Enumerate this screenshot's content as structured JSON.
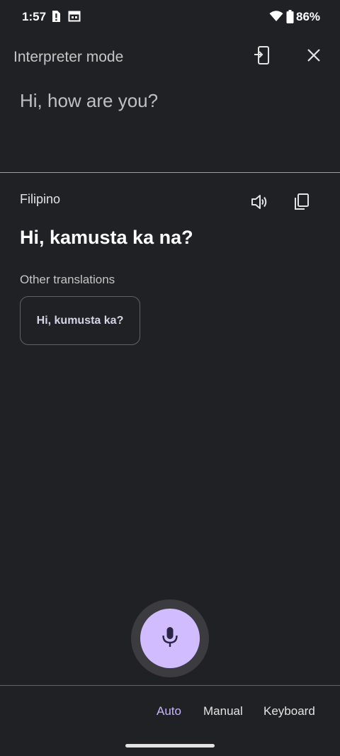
{
  "status_bar": {
    "time": "1:57",
    "battery": "86%",
    "icons": [
      "alert-icon",
      "calendar-icon",
      "wifi-icon",
      "battery-icon"
    ]
  },
  "header": {
    "title": "Interpreter mode",
    "icons": [
      "exit-interpreter-icon",
      "close-icon"
    ]
  },
  "source": {
    "text": "Hi, how are you?"
  },
  "translation": {
    "language": "Filipino",
    "text": "Hi, kamusta ka na?",
    "icons": [
      "speaker-icon",
      "copy-icon"
    ]
  },
  "other_translations": {
    "label": "Other translations",
    "items": [
      "Hi, kumusta ka?"
    ]
  },
  "modes": {
    "selected": "Auto",
    "tabs": [
      "Auto",
      "Manual",
      "Keyboard"
    ]
  },
  "colors": {
    "background": "#202124",
    "accent": "#d0bcff",
    "selected_tab": "#c7b6f7"
  }
}
